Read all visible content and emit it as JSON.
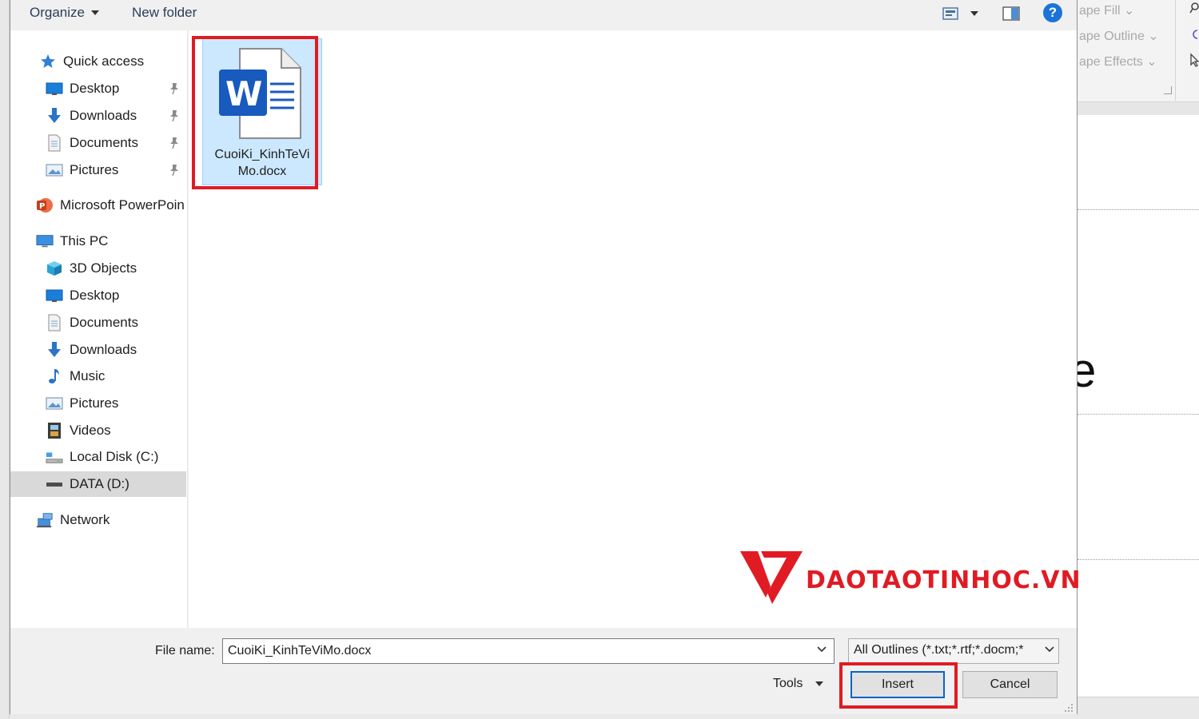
{
  "toolbar": {
    "organize_label": "Organize",
    "new_folder_label": "New folder",
    "help_label": "?"
  },
  "sidebar": {
    "items": [
      {
        "label": "Quick access",
        "icon": "star-icon",
        "level": 0
      },
      {
        "label": "Desktop",
        "icon": "desktop-icon",
        "level": 1,
        "pinned": true
      },
      {
        "label": "Downloads",
        "icon": "download-arrow-icon",
        "level": 1,
        "pinned": true
      },
      {
        "label": "Documents",
        "icon": "document-icon",
        "level": 1,
        "pinned": true
      },
      {
        "label": "Pictures",
        "icon": "pictures-icon",
        "level": 1,
        "pinned": true
      },
      {
        "label": "Microsoft PowerPoin",
        "icon": "powerpoint-icon",
        "level": 0
      },
      {
        "label": "This PC",
        "icon": "computer-icon",
        "level": 0
      },
      {
        "label": "3D Objects",
        "icon": "cube-icon",
        "level": 1
      },
      {
        "label": "Desktop",
        "icon": "desktop-icon",
        "level": 1
      },
      {
        "label": "Documents",
        "icon": "document-icon",
        "level": 1
      },
      {
        "label": "Downloads",
        "icon": "download-arrow-icon",
        "level": 1
      },
      {
        "label": "Music",
        "icon": "music-note-icon",
        "level": 1
      },
      {
        "label": "Pictures",
        "icon": "pictures-icon",
        "level": 1
      },
      {
        "label": "Videos",
        "icon": "film-icon",
        "level": 1
      },
      {
        "label": "Local Disk (C:)",
        "icon": "system-drive-icon",
        "level": 1
      },
      {
        "label": "DATA (D:)",
        "icon": "drive-icon",
        "level": 1,
        "selected": true
      },
      {
        "label": "Network",
        "icon": "network-icon",
        "level": 0
      }
    ]
  },
  "files": [
    {
      "name": "CuoiKi_KinhTeViMo.docx",
      "icon": "word-doc-icon",
      "selected": true
    }
  ],
  "bottom": {
    "file_name_label": "File name:",
    "file_name_value": "CuoiKi_KinhTeViMo.docx",
    "filter_value": "All Outlines (*.txt;*.rtf;*.docm;*",
    "tools_label": "Tools",
    "insert_label": "Insert",
    "cancel_label": "Cancel"
  },
  "background_ribbon": {
    "shape_fill": "ape Fill",
    "shape_outline": "ape Outline",
    "shape_effects": "ape Effects",
    "slide_fragment": "e"
  },
  "watermark": {
    "text": "DAOTAOTINHOC.VN"
  },
  "colors": {
    "highlight_red": "#e01b24",
    "selection_blue": "#cce8ff",
    "word_blue": "#185abd",
    "focus_blue": "#0a63c9"
  }
}
